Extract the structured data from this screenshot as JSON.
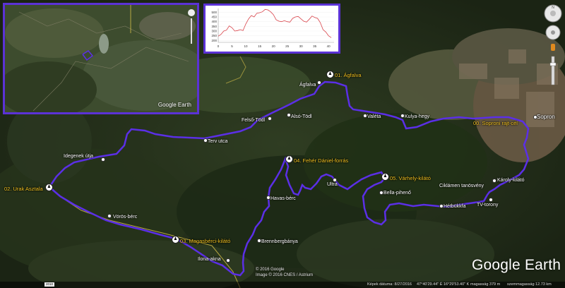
{
  "track_color": "#5b2fe6",
  "waypoint_color": "#f0c020",
  "brand": "Google Earth",
  "inset": {
    "brand": "Google Earth"
  },
  "credits": {
    "line1": "© 2016 Google",
    "line2": "Image © 2016 CNES / Astrium"
  },
  "profile": {
    "y_ticks": [
      "500",
      "450",
      "400",
      "350",
      "300",
      "250",
      "200"
    ],
    "x_ticks": [
      "0",
      "5",
      "10",
      "15",
      "20",
      "25",
      "30",
      "35",
      "40"
    ],
    "x": [
      0,
      1,
      2,
      3,
      4,
      5,
      6,
      7,
      8,
      9,
      10,
      11,
      12,
      13,
      14,
      15,
      16,
      17,
      18,
      19,
      20,
      21,
      22,
      23,
      24,
      25,
      26,
      27,
      28,
      29,
      30,
      31,
      32,
      33,
      34,
      35,
      36,
      37,
      38,
      39,
      40,
      41
    ],
    "elevation": [
      245,
      265,
      300,
      310,
      355,
      335,
      300,
      305,
      315,
      305,
      375,
      430,
      465,
      450,
      490,
      495,
      505,
      530,
      525,
      505,
      475,
      420,
      405,
      400,
      410,
      400,
      395,
      435,
      450,
      455,
      430,
      405,
      395,
      425,
      460,
      445,
      435,
      390,
      315,
      290,
      250,
      230
    ],
    "y_min": 180,
    "y_max": 540,
    "x_max": 42
  },
  "waypoints": [
    {
      "label": "01. Ágfalva"
    },
    {
      "label": "00. Soproni rajt-cél"
    },
    {
      "label": "02. Urak Asztala"
    },
    {
      "label": "03. Magasbérci-kilátó"
    },
    {
      "label": "04. Fehér Dániel-forrás"
    },
    {
      "label": "05. Várhely-kilátó"
    }
  ],
  "places": [
    {
      "label": "Ágfalva"
    },
    {
      "label": "Alsó-Tödl"
    },
    {
      "label": "Felső-Tödl"
    },
    {
      "label": "Valéta"
    },
    {
      "label": "Kulya-hegy"
    },
    {
      "label": "Sopron"
    },
    {
      "label": "Terv utca"
    },
    {
      "label": "Idegenek útja"
    },
    {
      "label": "Ultra"
    },
    {
      "label": "Bella-pihenő"
    },
    {
      "label": "Ciklámen tanösvény"
    },
    {
      "label": "Károly-kilátó"
    },
    {
      "label": "Hétbükkfa"
    },
    {
      "label": "TV-torony"
    },
    {
      "label": "Havas-bérc"
    },
    {
      "label": "Vörös-bérc"
    },
    {
      "label": "Brennbergbánya"
    },
    {
      "label": "Ilona-akna"
    }
  ],
  "status": {
    "scale_btn": "2010",
    "date": "Képek dátuma: 8/27/2016",
    "coords": "47°40'29.44\" É   16°29'53.40\" K",
    "elev": "magasság   379 m",
    "eye": "szemmagasság   12.73 km"
  }
}
